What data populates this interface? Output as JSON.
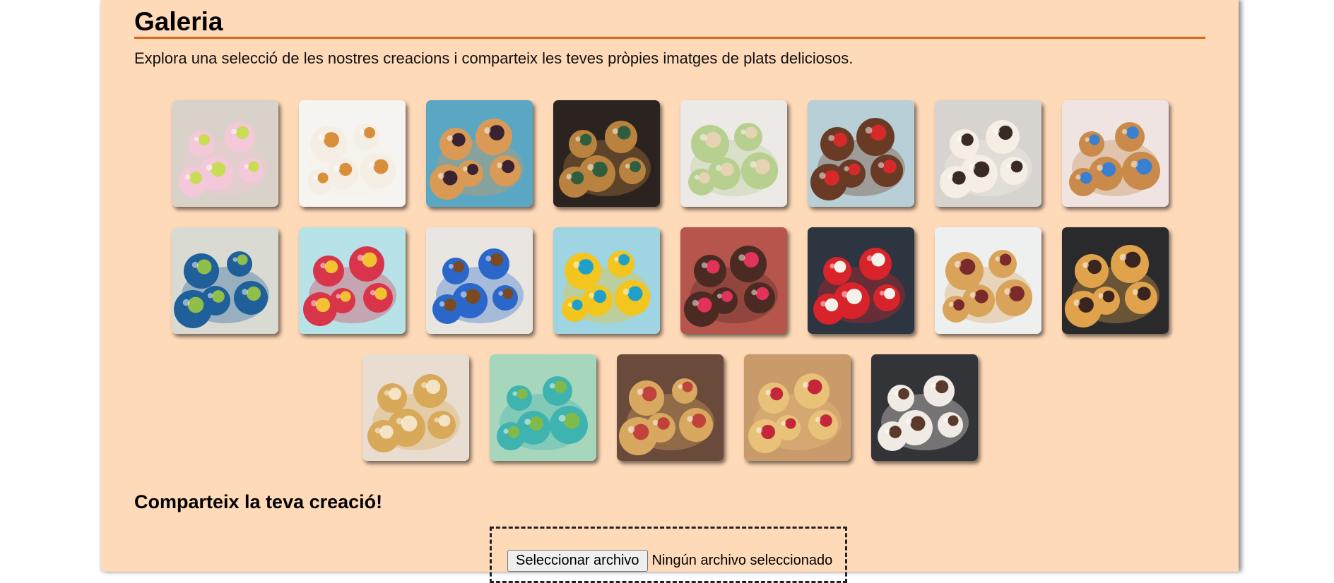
{
  "gallery": {
    "title": "Galeria",
    "intro": "Explora una selecció de les nostres creacions i comparteix les teves pròpies imatges de plats deliciosos."
  },
  "colors": {
    "page_background": "#ffdab9",
    "accent_line": "#d2691e"
  },
  "rows": [
    [
      {
        "name": "panda-bear-buns",
        "bg": "#d8d2c8",
        "fg": "#f3c8d8",
        "accent": "#c8dd55"
      },
      {
        "name": "cat-buns",
        "bg": "#f6f4f0",
        "fg": "#f5eee4",
        "accent": "#d98e3a"
      },
      {
        "name": "taiyaki-fish-cakes",
        "bg": "#5aa7c4",
        "fg": "#d99a55",
        "accent": "#3b2230"
      },
      {
        "name": "mooncakes",
        "bg": "#2a2320",
        "fg": "#b9823e",
        "accent": "#2f5e3e"
      },
      {
        "name": "christmas-tree-cookies",
        "bg": "#ece9e6",
        "fg": "#b7cf8f",
        "accent": "#e6d3b3"
      },
      {
        "name": "reindeer-cupcakes",
        "bg": "#b9cfd8",
        "fg": "#6a3b24",
        "accent": "#d62a2a"
      },
      {
        "name": "snowman-cakes",
        "bg": "#d7d4d0",
        "fg": "#f4eee4",
        "accent": "#3a2a24"
      },
      {
        "name": "teddy-bear-cakes",
        "bg": "#efe4e2",
        "fg": "#c98a4a",
        "accent": "#3a7fd0"
      }
    ],
    [
      {
        "name": "blue-glazed-donut",
        "bg": "#d9dbd3",
        "fg": "#1f5f9a",
        "accent": "#8fbf4a"
      },
      {
        "name": "watermelon-donut",
        "bg": "#b7e3e8",
        "fg": "#d9354a",
        "accent": "#f2c232"
      },
      {
        "name": "cookie-monster-cupcakes",
        "bg": "#e9e6e2",
        "fg": "#2a67c9",
        "accent": "#7a4a22"
      },
      {
        "name": "minion-cupcakes",
        "bg": "#9fd4e2",
        "fg": "#f2c51f",
        "accent": "#1fa0c8"
      },
      {
        "name": "raspberry-brownies",
        "bg": "#b5554b",
        "fg": "#4a2a22",
        "accent": "#e0325a"
      },
      {
        "name": "heart-layer-cake",
        "bg": "#2c3540",
        "fg": "#d9232a",
        "accent": "#f4f0ea"
      },
      {
        "name": "mummy-pastries",
        "bg": "#eef0f0",
        "fg": "#d9a45a",
        "accent": "#7a2a2a"
      },
      {
        "name": "spider-cookies",
        "bg": "#2a2a2c",
        "fg": "#e0a24a",
        "accent": "#3a2420"
      }
    ],
    [
      {
        "name": "puff-pastry-tart",
        "bg": "#e8ddd0",
        "fg": "#d9a95a",
        "accent": "#f4e4c4"
      },
      {
        "name": "succulent-cupcakes",
        "bg": "#a6d7bd",
        "fg": "#3fb3b0",
        "accent": "#7fba4a"
      },
      {
        "name": "vegetable-puff-pastries",
        "bg": "#6a4a3a",
        "fg": "#d9a860",
        "accent": "#c0423a"
      },
      {
        "name": "raspberry-puff-pastries",
        "bg": "#c99a6a",
        "fg": "#e9c27a",
        "accent": "#c4263a"
      },
      {
        "name": "tiramisu-slice",
        "bg": "#333438",
        "fg": "#f0ebe4",
        "accent": "#5a3a2a"
      }
    ]
  ],
  "share": {
    "title": "Comparteix la teva creació!",
    "button_label": "Seleccionar archivo",
    "status": "Ningún archivo seleccionado"
  }
}
